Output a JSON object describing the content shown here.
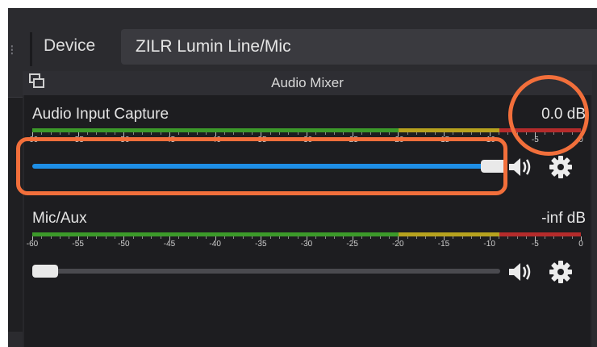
{
  "topbar": {
    "device_label": "Device",
    "device_value": "ZILR Lumin Line/Mic"
  },
  "panel": {
    "title": "Audio Mixer"
  },
  "channels": [
    {
      "name": "Audio Input Capture",
      "level": "0.0 dB",
      "volume_fraction": 1.0
    },
    {
      "name": "Mic/Aux",
      "level": "-inf dB",
      "volume_fraction": 0.0
    }
  ],
  "meter_scale": [
    "-60",
    "-55",
    "-50",
    "-45",
    "-40",
    "-35",
    "-30",
    "-25",
    "-20",
    "-15",
    "-10",
    "-5",
    "0"
  ],
  "colors": {
    "accent": "#1e8fe6",
    "highlight": "#f26f3b",
    "meter_green": "#3c9a2a",
    "meter_yellow": "#b7a21e",
    "meter_red": "#b52b2b"
  },
  "icons": {
    "undock": "undock-icon",
    "mute": "speaker-icon",
    "settings": "gear-icon"
  }
}
